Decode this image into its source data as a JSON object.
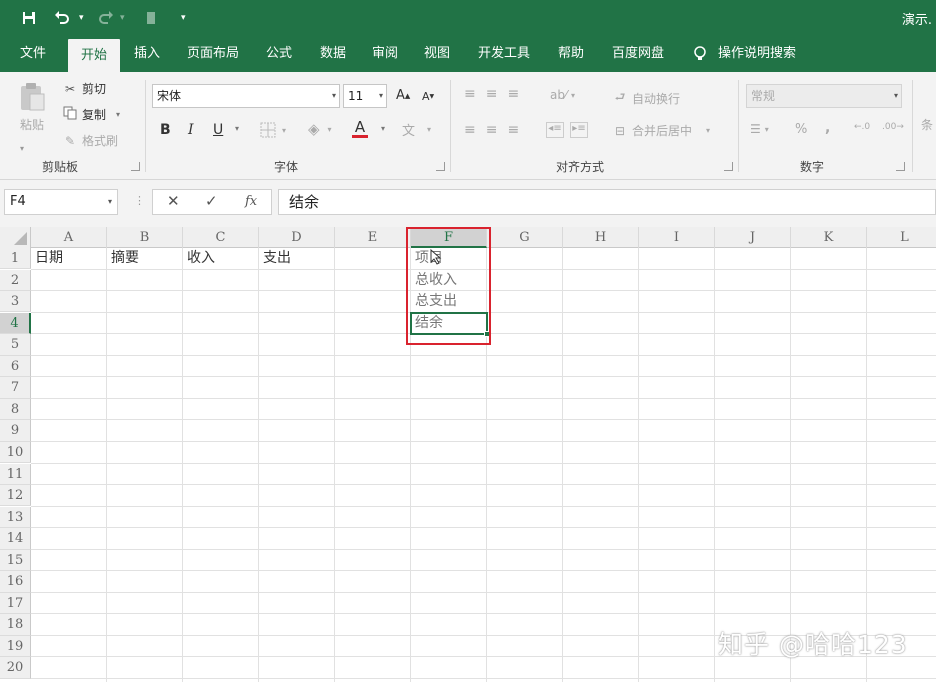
{
  "window": {
    "title": "演示."
  },
  "tabs": [
    {
      "label": "文件"
    },
    {
      "label": "开始"
    },
    {
      "label": "插入"
    },
    {
      "label": "页面布局"
    },
    {
      "label": "公式"
    },
    {
      "label": "数据"
    },
    {
      "label": "审阅"
    },
    {
      "label": "视图"
    },
    {
      "label": "开发工具"
    },
    {
      "label": "帮助"
    },
    {
      "label": "百度网盘"
    },
    {
      "label": "操作说明搜索"
    }
  ],
  "ribbon": {
    "clipboard": {
      "label": "剪贴板",
      "paste": "粘贴",
      "cut": "剪切",
      "copy": "复制",
      "format_painter": "格式刷"
    },
    "font": {
      "label": "字体",
      "font_name": "宋体",
      "font_size": "11",
      "bold": "B",
      "italic": "I",
      "underline": "U",
      "grow": "A",
      "shrink": "A",
      "font_color": "A"
    },
    "alignment": {
      "label": "对齐方式",
      "wrap_text": "自动换行",
      "merge_center": "合并后居中"
    },
    "number": {
      "label": "数字",
      "format": "常规",
      "percent": "%",
      "comma": ","
    },
    "styles": {
      "partial": "条"
    }
  },
  "formula_bar": {
    "name_box": "F4",
    "cancel": "✕",
    "enter": "✓",
    "fx": "fx",
    "content": "结余"
  },
  "columns": [
    "A",
    "B",
    "C",
    "D",
    "E",
    "F",
    "G",
    "H",
    "I",
    "J",
    "K",
    "L"
  ],
  "rows": [
    "1",
    "2",
    "3",
    "4",
    "5",
    "6",
    "7",
    "8",
    "9",
    "10",
    "11",
    "12",
    "13",
    "14",
    "15",
    "16",
    "17",
    "18",
    "19",
    "20"
  ],
  "cells": {
    "A1": "日期",
    "B1": "摘要",
    "C1": "收入",
    "D1": "支出",
    "F1": "项目",
    "F2": "总收入",
    "F3": "总支出",
    "F4": "结余"
  },
  "selected": {
    "column": "F",
    "row": "4"
  },
  "watermark": "知乎 @哈哈123"
}
